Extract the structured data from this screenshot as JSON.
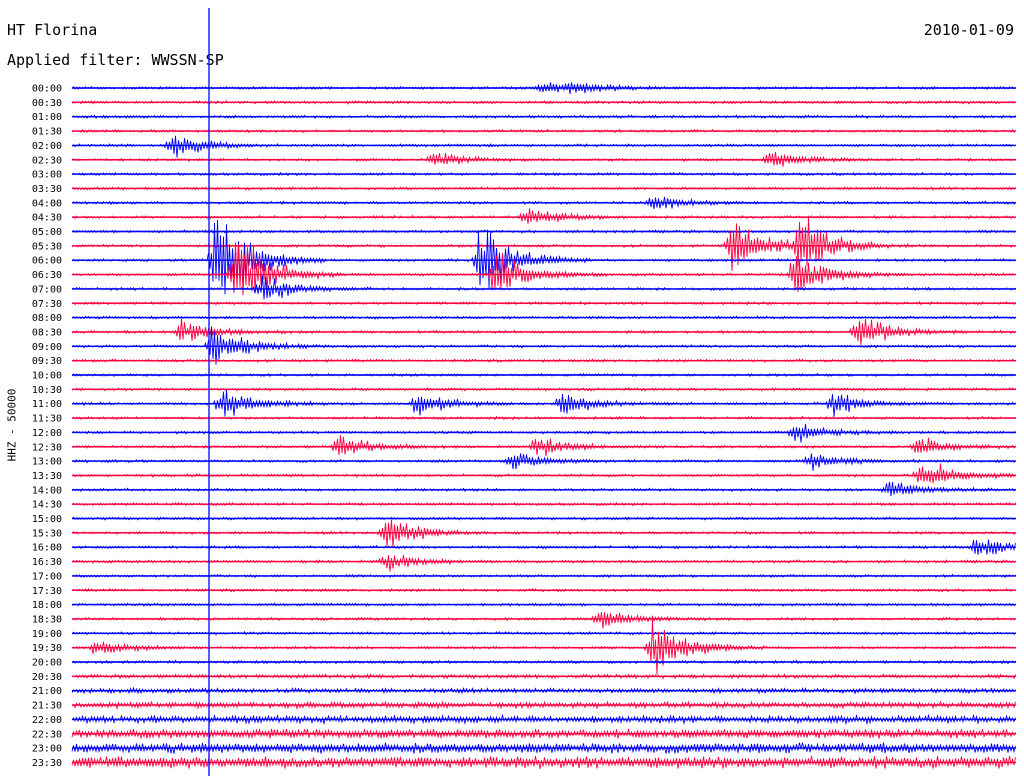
{
  "header": {
    "station": "HT Florina",
    "date": "2010-01-09",
    "filter": "Applied filter: WWSSN-SP"
  },
  "chart_data": {
    "type": "line",
    "subtype": "helicorder",
    "title": "HT Florina",
    "date": "2010-01-09",
    "filter_label": "Applied filter: WWSSN-SP",
    "ylabel": "HHZ - 50000",
    "row_labels": [
      "00:00",
      "00:30",
      "01:00",
      "01:30",
      "02:00",
      "02:30",
      "03:00",
      "03:30",
      "04:00",
      "04:30",
      "05:00",
      "05:30",
      "06:00",
      "06:30",
      "07:00",
      "07:30",
      "08:00",
      "08:30",
      "09:00",
      "09:30",
      "10:00",
      "10:30",
      "11:00",
      "11:30",
      "12:00",
      "12:30",
      "13:00",
      "13:30",
      "14:00",
      "14:30",
      "15:00",
      "15:30",
      "16:00",
      "16:30",
      "17:00",
      "17:30",
      "18:00",
      "18:30",
      "19:00",
      "19:30",
      "20:00",
      "20:30",
      "21:00",
      "21:30",
      "22:00",
      "22:30",
      "23:00",
      "23:30"
    ],
    "trace_colors": [
      "#0000ff",
      "#ff0040"
    ],
    "row_minutes": 30,
    "amplitude_scale": 50000,
    "grid": false,
    "legend": "none",
    "events": [
      {
        "row": 0,
        "minute": 15.0,
        "amp": 0.4
      },
      {
        "row": 0,
        "minute": 16.0,
        "amp": 0.4
      },
      {
        "row": 4,
        "minute": 3.2,
        "amp": 0.9
      },
      {
        "row": 5,
        "minute": 11.5,
        "amp": 0.5
      },
      {
        "row": 5,
        "minute": 22.2,
        "amp": 0.6
      },
      {
        "row": 8,
        "minute": 18.5,
        "amp": 0.6
      },
      {
        "row": 9,
        "minute": 14.5,
        "amp": 0.7
      },
      {
        "row": 11,
        "minute": 21.0,
        "amp": 2.0
      },
      {
        "row": 11,
        "minute": 23.2,
        "amp": 2.0
      },
      {
        "row": 12,
        "minute": 4.6,
        "amp": 4.0
      },
      {
        "row": 12,
        "minute": 13.0,
        "amp": 2.5
      },
      {
        "row": 13,
        "minute": 5.2,
        "amp": 3.0
      },
      {
        "row": 13,
        "minute": 13.5,
        "amp": 1.5
      },
      {
        "row": 13,
        "minute": 23.0,
        "amp": 1.5
      },
      {
        "row": 14,
        "minute": 6.0,
        "amp": 1.0
      },
      {
        "row": 17,
        "minute": 3.5,
        "amp": 0.8
      },
      {
        "row": 17,
        "minute": 25.0,
        "amp": 1.2
      },
      {
        "row": 18,
        "minute": 4.5,
        "amp": 1.5
      },
      {
        "row": 22,
        "minute": 4.8,
        "amp": 1.2
      },
      {
        "row": 22,
        "minute": 11.0,
        "amp": 0.8
      },
      {
        "row": 22,
        "minute": 15.6,
        "amp": 0.8
      },
      {
        "row": 22,
        "minute": 24.2,
        "amp": 0.8
      },
      {
        "row": 24,
        "minute": 23.0,
        "amp": 0.7
      },
      {
        "row": 25,
        "minute": 8.5,
        "amp": 0.8
      },
      {
        "row": 25,
        "minute": 14.8,
        "amp": 0.7
      },
      {
        "row": 25,
        "minute": 26.9,
        "amp": 0.7
      },
      {
        "row": 26,
        "minute": 14.0,
        "amp": 0.7
      },
      {
        "row": 26,
        "minute": 23.5,
        "amp": 0.6
      },
      {
        "row": 27,
        "minute": 27.0,
        "amp": 1.2
      },
      {
        "row": 28,
        "minute": 26.0,
        "amp": 0.6
      },
      {
        "row": 31,
        "minute": 10.0,
        "amp": 1.2
      },
      {
        "row": 32,
        "minute": 28.8,
        "amp": 0.8
      },
      {
        "row": 33,
        "minute": 10.0,
        "amp": 0.6
      },
      {
        "row": 37,
        "minute": 16.8,
        "amp": 0.7
      },
      {
        "row": 39,
        "minute": 18.5,
        "amp": 2.0
      },
      {
        "row": 39,
        "minute": 0.8,
        "amp": 0.6
      }
    ]
  }
}
